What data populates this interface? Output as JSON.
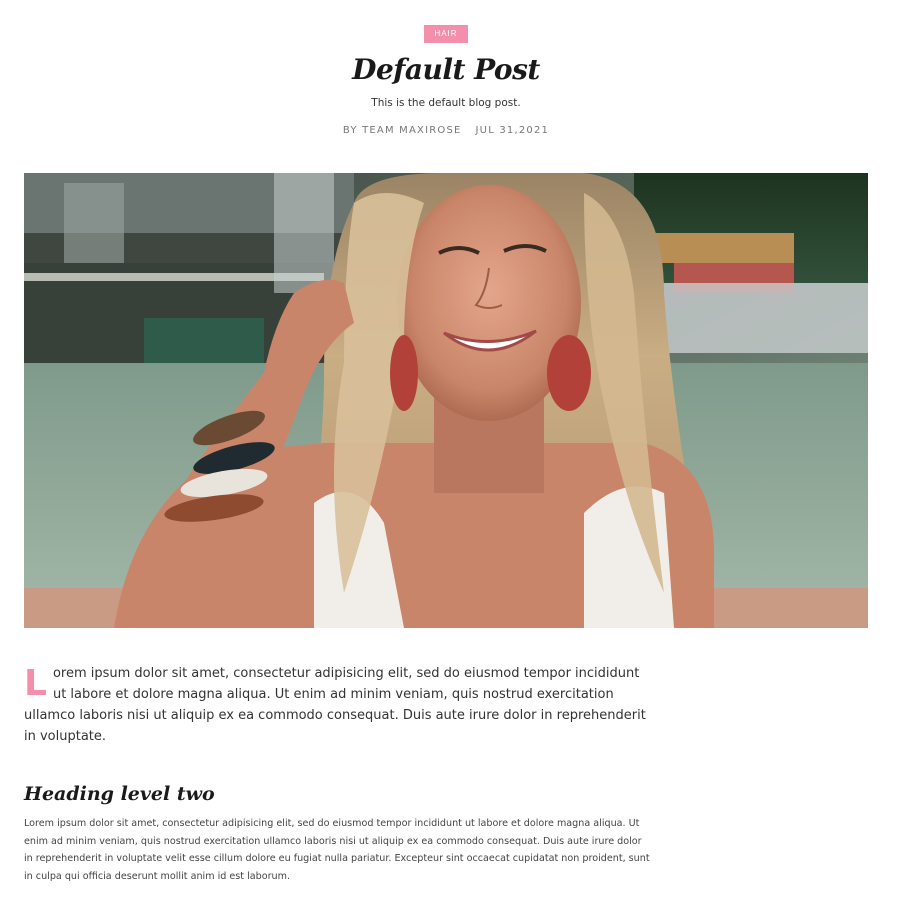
{
  "post": {
    "category": "HAIR",
    "title": "Default Post",
    "subtitle": "This is the default blog post.",
    "author": "BY TEAM MAXIROSE",
    "date": "JUL 31,2021"
  },
  "hero": {
    "alt_icon": "portrait-photo"
  },
  "content": {
    "drop_cap": "L",
    "intro_rest": "orem ipsum dolor sit amet, consectetur adipisicing elit, sed do eiusmod tempor incididunt ut labore et dolore magna aliqua. Ut enim ad minim veniam, quis nostrud exercitation ullamco laboris nisi ut aliquip ex ea commodo consequat. Duis aute irure dolor in reprehenderit in voluptate.",
    "heading_two": "Heading level two",
    "body_two": "Lorem ipsum dolor sit amet, consectetur adipisicing elit, sed do eiusmod tempor incididunt ut labore et dolore magna aliqua. Ut enim ad minim veniam, quis nostrud exercitation ullamco laboris nisi ut aliquip ex ea commodo consequat. Duis aute irure dolor in reprehenderit in voluptate velit esse cillum dolore eu fugiat nulla pariatur. Excepteur sint occaecat cupidatat non proident, sunt in culpa qui officia deserunt mollit anim id est laborum."
  },
  "colors": {
    "accent": "#f48fab",
    "text": "#333333",
    "meta": "#777777"
  }
}
